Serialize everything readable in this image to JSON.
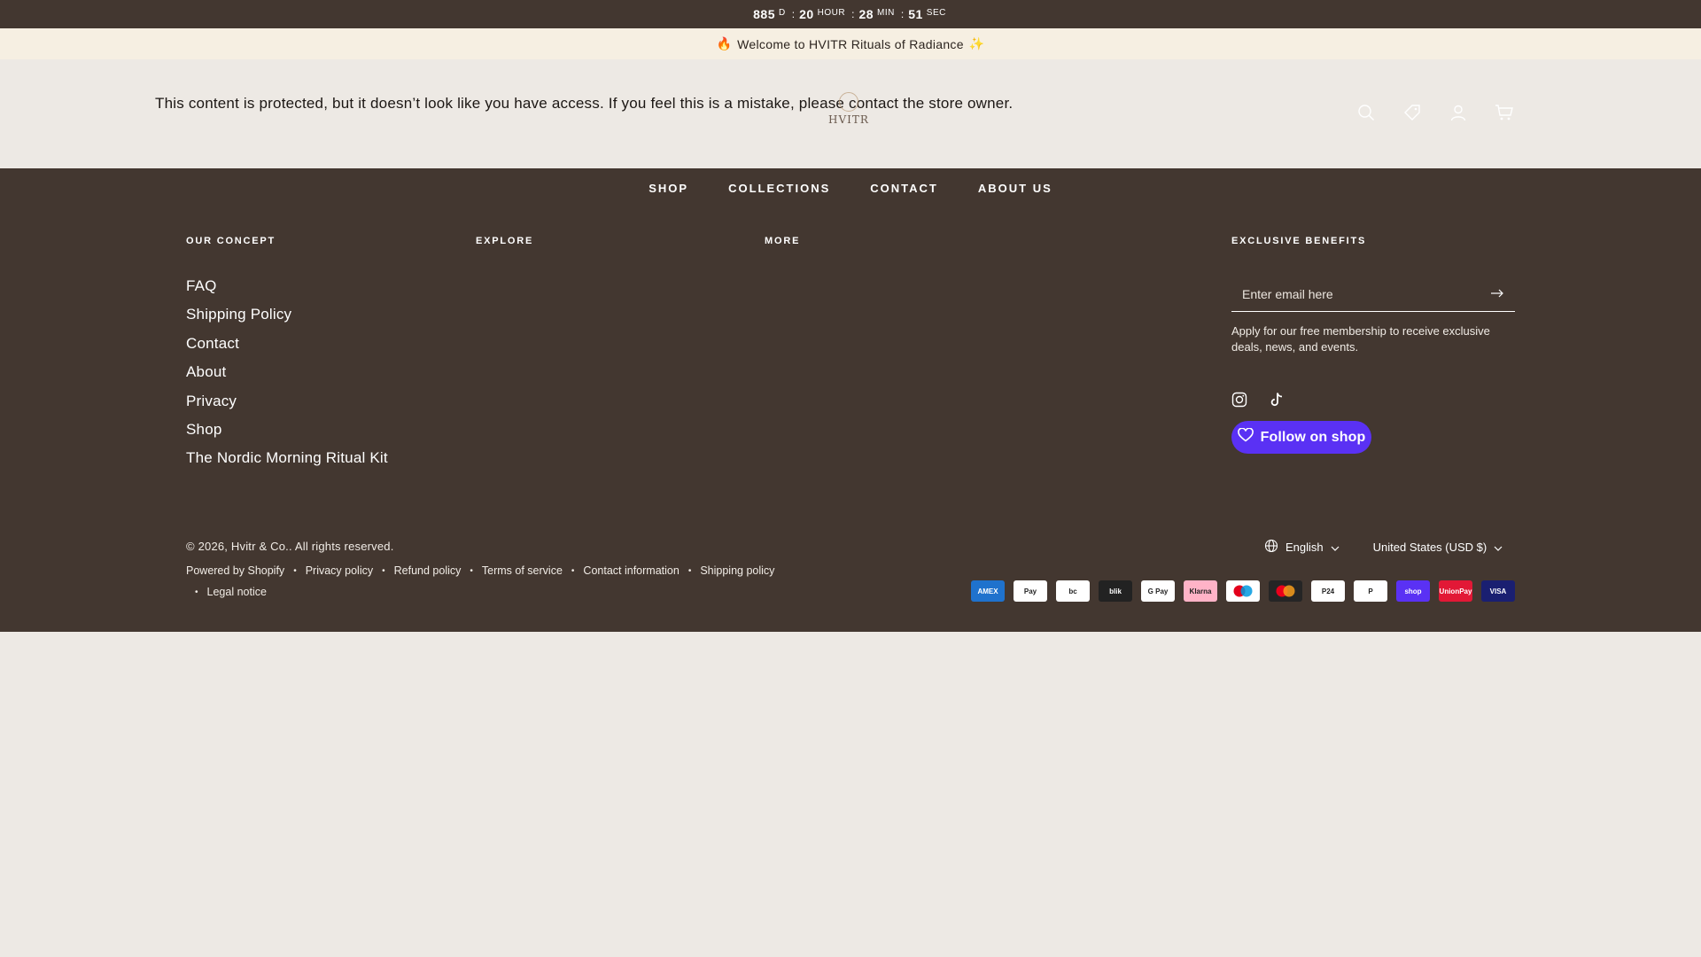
{
  "countdown": {
    "days": "885",
    "days_unit": "D",
    "hours": "20",
    "hours_unit": "HOUR",
    "minutes": "28",
    "minutes_unit": "MIN",
    "seconds": "51",
    "seconds_unit": "SEC",
    "separator": ":"
  },
  "announcement": {
    "text": "Welcome to HVITR Rituals of Radiance",
    "lead_emoji": "🔥",
    "trail_emoji": "✨"
  },
  "header": {
    "protected_message": "This content is protected, but it doesn’t look like you have access. If you feel this is a mistake, please contact the store owner.",
    "logo_text": "HVITR",
    "icons": [
      "search-icon",
      "tag-icon",
      "account-icon",
      "cart-icon"
    ]
  },
  "nav": {
    "items": [
      "SHOP",
      "COLLECTIONS",
      "CONTACT",
      "ABOUT US"
    ]
  },
  "footer": {
    "columns": {
      "concept": "OUR CONCEPT",
      "explore": "EXPLORE",
      "more": "MORE",
      "benefits": "EXCLUSIVE BENEFITS"
    },
    "links": [
      "FAQ",
      "Shipping Policy",
      "Contact",
      "About",
      "Privacy",
      "Shop",
      "The Nordic Morning Ritual Kit"
    ],
    "email_placeholder": "Enter email here",
    "benefits_text": "Apply for our free membership to receive exclusive deals, news, and events.",
    "social": [
      "instagram-icon",
      "tiktok-icon"
    ],
    "follow_button": "Follow on shop",
    "copyright": "© 2026, Hvitr & Co.. All rights reserved.",
    "policies": [
      "Powered by Shopify",
      "Privacy policy",
      "Refund policy",
      "Terms of service",
      "Contact information",
      "Shipping policy",
      "Legal notice"
    ],
    "language": "English",
    "currency": "United States (USD $)",
    "payment_methods": [
      {
        "name": "American Express",
        "label": "AMEX",
        "color": "#1f72cd"
      },
      {
        "name": "Apple Pay",
        "label": "Pay",
        "color": "#ffffff"
      },
      {
        "name": "Bancontact",
        "label": "bc",
        "color": "#ffffff"
      },
      {
        "name": "BLIK",
        "label": "blik",
        "color": "#222222"
      },
      {
        "name": "Google Pay",
        "label": "G Pay",
        "color": "#ffffff"
      },
      {
        "name": "Klarna",
        "label": "Klarna",
        "color": "#ffb3c7"
      },
      {
        "name": "Maestro",
        "label": "",
        "color": "#ffffff"
      },
      {
        "name": "Mastercard",
        "label": "",
        "color": "#252525"
      },
      {
        "name": "Przelewy",
        "label": "P24",
        "color": "#ffffff"
      },
      {
        "name": "PayPal",
        "label": "P",
        "color": "#ffffff"
      },
      {
        "name": "Shop Pay",
        "label": "shop",
        "color": "#5a31f4"
      },
      {
        "name": "UnionPay",
        "label": "UnionPay",
        "color": "#e21836"
      },
      {
        "name": "Visa",
        "label": "VISA",
        "color": "#1a1f71"
      }
    ]
  }
}
